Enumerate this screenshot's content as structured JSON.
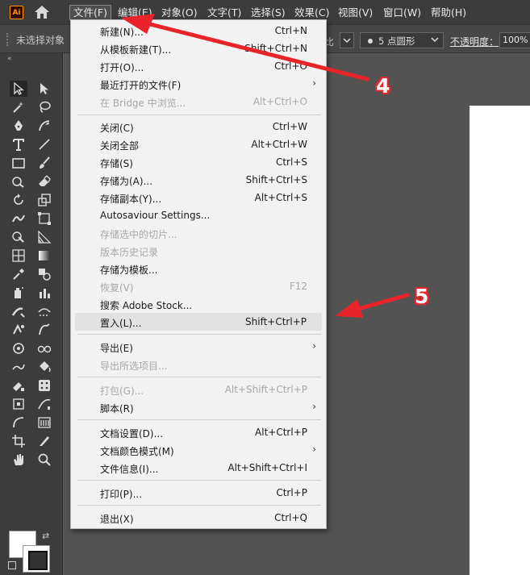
{
  "app": {
    "logo_text": "Ai",
    "menus": [
      "文件(F)",
      "编辑(E)",
      "对象(O)",
      "文字(T)",
      "选择(S)",
      "效果(C)",
      "视图(V)",
      "窗口(W)",
      "帮助(H)"
    ],
    "active_menu": "文件(F)"
  },
  "controlbar": {
    "selection_status": "未选择对象",
    "stroke_label": "比",
    "brush_label": "5 点圆形",
    "opacity_label": "不透明度：",
    "opacity_value": "100%"
  },
  "file_menu": {
    "items": [
      {
        "label": "新建(N)...",
        "shortcut": "Ctrl+N",
        "enabled": true
      },
      {
        "label": "从模板新建(T)...",
        "shortcut": "Shift+Ctrl+N",
        "enabled": true
      },
      {
        "label": "打开(O)...",
        "shortcut": "Ctrl+O",
        "enabled": true
      },
      {
        "label": "最近打开的文件(F)",
        "shortcut": "",
        "enabled": true,
        "submenu": true
      },
      {
        "label": "在 Bridge 中浏览...",
        "shortcut": "Alt+Ctrl+O",
        "enabled": false
      },
      {
        "label": "关闭(C)",
        "shortcut": "Ctrl+W",
        "enabled": true
      },
      {
        "label": "关闭全部",
        "shortcut": "Alt+Ctrl+W",
        "enabled": true
      },
      {
        "label": "存储(S)",
        "shortcut": "Ctrl+S",
        "enabled": true
      },
      {
        "label": "存储为(A)...",
        "shortcut": "Shift+Ctrl+S",
        "enabled": true
      },
      {
        "label": "存储副本(Y)...",
        "shortcut": "Alt+Ctrl+S",
        "enabled": true
      },
      {
        "label": "Autosaviour Settings...",
        "shortcut": "",
        "enabled": true
      },
      {
        "label": "存储选中的切片...",
        "shortcut": "",
        "enabled": false
      },
      {
        "label": "版本历史记录",
        "shortcut": "",
        "enabled": false
      },
      {
        "label": "存储为模板...",
        "shortcut": "",
        "enabled": true
      },
      {
        "label": "恢复(V)",
        "shortcut": "F12",
        "enabled": false
      },
      {
        "label": "搜索 Adobe Stock...",
        "shortcut": "",
        "enabled": true
      },
      {
        "label": "置入(L)...",
        "shortcut": "Shift+Ctrl+P",
        "enabled": true,
        "highlighted": true
      },
      {
        "label": "导出(E)",
        "shortcut": "",
        "enabled": true,
        "submenu": true
      },
      {
        "label": "导出所选项目...",
        "shortcut": "",
        "enabled": false
      },
      {
        "label": "打包(G)...",
        "shortcut": "Alt+Shift+Ctrl+P",
        "enabled": false
      },
      {
        "label": "脚本(R)",
        "shortcut": "",
        "enabled": true,
        "submenu": true
      },
      {
        "label": "文档设置(D)...",
        "shortcut": "Alt+Ctrl+P",
        "enabled": true
      },
      {
        "label": "文档颜色模式(M)",
        "shortcut": "",
        "enabled": true,
        "submenu": true
      },
      {
        "label": "文件信息(I)...",
        "shortcut": "Alt+Shift+Ctrl+I",
        "enabled": true
      },
      {
        "label": "打印(P)...",
        "shortcut": "Ctrl+P",
        "enabled": true
      },
      {
        "label": "退出(X)",
        "shortcut": "Ctrl+Q",
        "enabled": true
      }
    ]
  },
  "annotations": {
    "step_a": "4",
    "step_b": "5",
    "arrow_color": "#e8242a"
  },
  "colors": {
    "menubar": "#3c3c3c",
    "canvas": "#535353",
    "menu_bg": "#f2f2f2",
    "accent": "#ff9a00"
  }
}
